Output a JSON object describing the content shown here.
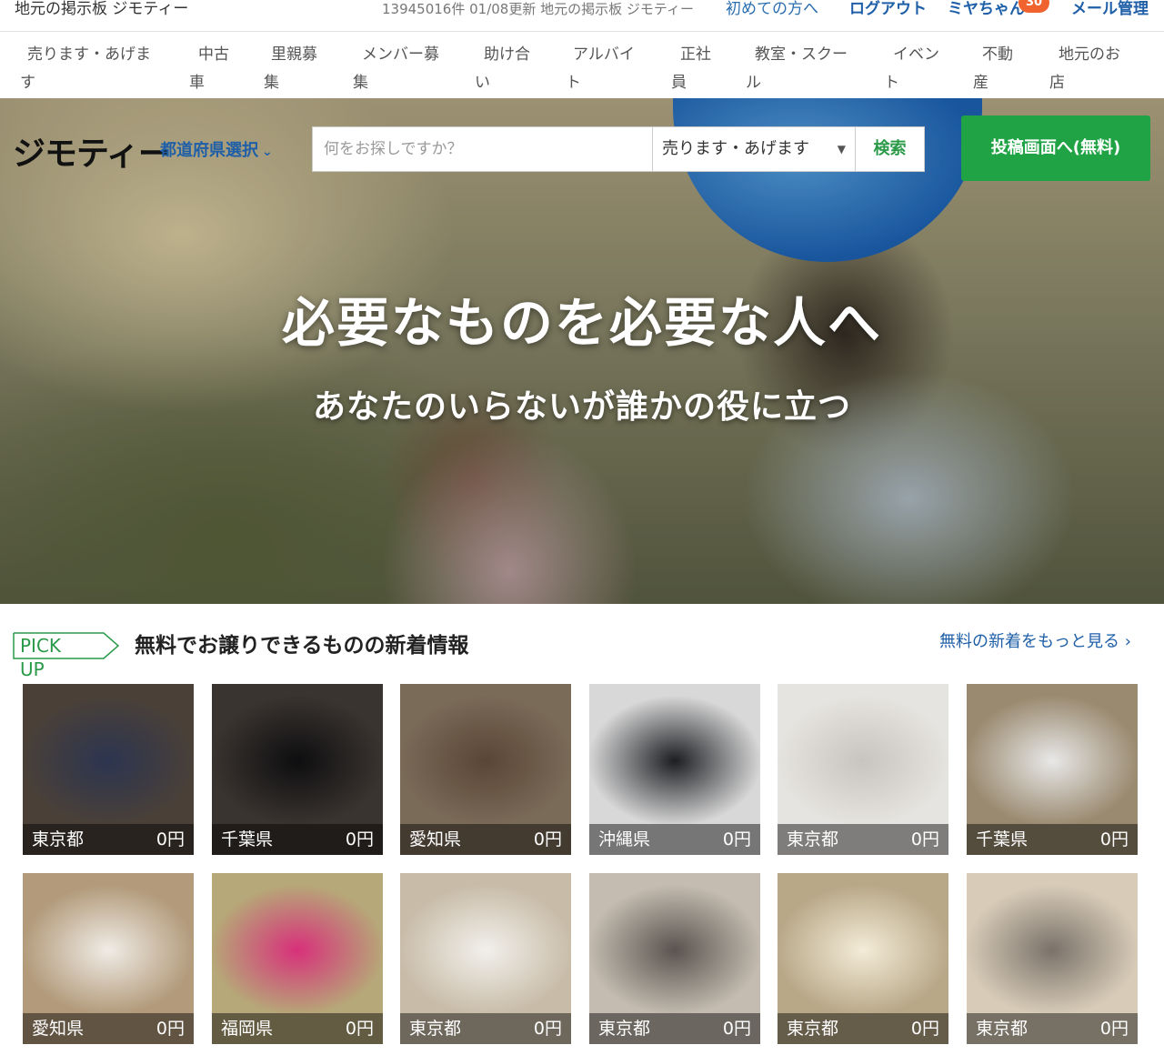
{
  "topbar": {
    "site_title": "地元の掲示板 ジモティー",
    "stats": "13945016件 01/08更新 地元の掲示板 ジモティー",
    "first_time": "初めての方へ",
    "logout": "ログアウト",
    "user_name": "ミヤちゃん",
    "notif_count": "30",
    "mail_settings": "メール管理"
  },
  "categories": [
    [
      "売ります・あげま",
      "す"
    ],
    [
      "中古",
      "車"
    ],
    [
      "里親募",
      "集"
    ],
    [
      "メンバー募",
      "集"
    ],
    [
      "助け合",
      "い"
    ],
    [
      "アルバイ",
      "ト"
    ],
    [
      "正社",
      "員"
    ],
    [
      "教室・スクー",
      "ル"
    ],
    [
      "イベン",
      "ト"
    ],
    [
      "不動",
      "産"
    ],
    [
      "地元のお",
      "店"
    ]
  ],
  "header": {
    "logo": "ジモティー",
    "pref_select": "都道府県選択",
    "search_placeholder": "何をお探しですか？",
    "category_value": "売ります・あげます",
    "search_button": "検索",
    "post_button": "投稿画面へ(無料)"
  },
  "hero": {
    "headline": "必要なものを必要な人へ",
    "subline": "あなたのいらないが誰かの役に立つ"
  },
  "pickup": {
    "tag": "PICK UP",
    "title": "無料でお譲りできるものの新着情報",
    "more_link": "無料の新着をもっと見る ›",
    "items": [
      {
        "pref": "東京都",
        "price": "0円",
        "color": "#4a4038",
        "accent": "#2c3550"
      },
      {
        "pref": "千葉県",
        "price": "0円",
        "color": "#3a3430",
        "accent": "#0e0e10"
      },
      {
        "pref": "愛知県",
        "price": "0円",
        "color": "#7a6a58",
        "accent": "#5a4636"
      },
      {
        "pref": "沖縄県",
        "price": "0円",
        "color": "#d8d8d8",
        "accent": "#1c1e22"
      },
      {
        "pref": "東京都",
        "price": "0円",
        "color": "#e6e4e0",
        "accent": "#c8c4be"
      },
      {
        "pref": "千葉県",
        "price": "0円",
        "color": "#9a8a70",
        "accent": "#e8e8e8"
      },
      {
        "pref": "愛知県",
        "price": "0円",
        "color": "#b29a7a",
        "accent": "#f0ece6"
      },
      {
        "pref": "福岡県",
        "price": "0円",
        "color": "#b6a878",
        "accent": "#d8307a"
      },
      {
        "pref": "東京都",
        "price": "0円",
        "color": "#c8bca8",
        "accent": "#f2f0ec"
      },
      {
        "pref": "東京都",
        "price": "0円",
        "color": "#c4bcb0",
        "accent": "#5a5450"
      },
      {
        "pref": "東京都",
        "price": "0円",
        "color": "#b8a888",
        "accent": "#f4ecd8"
      },
      {
        "pref": "東京都",
        "price": "0円",
        "color": "#d8ccb8",
        "accent": "#7a726a"
      }
    ]
  }
}
